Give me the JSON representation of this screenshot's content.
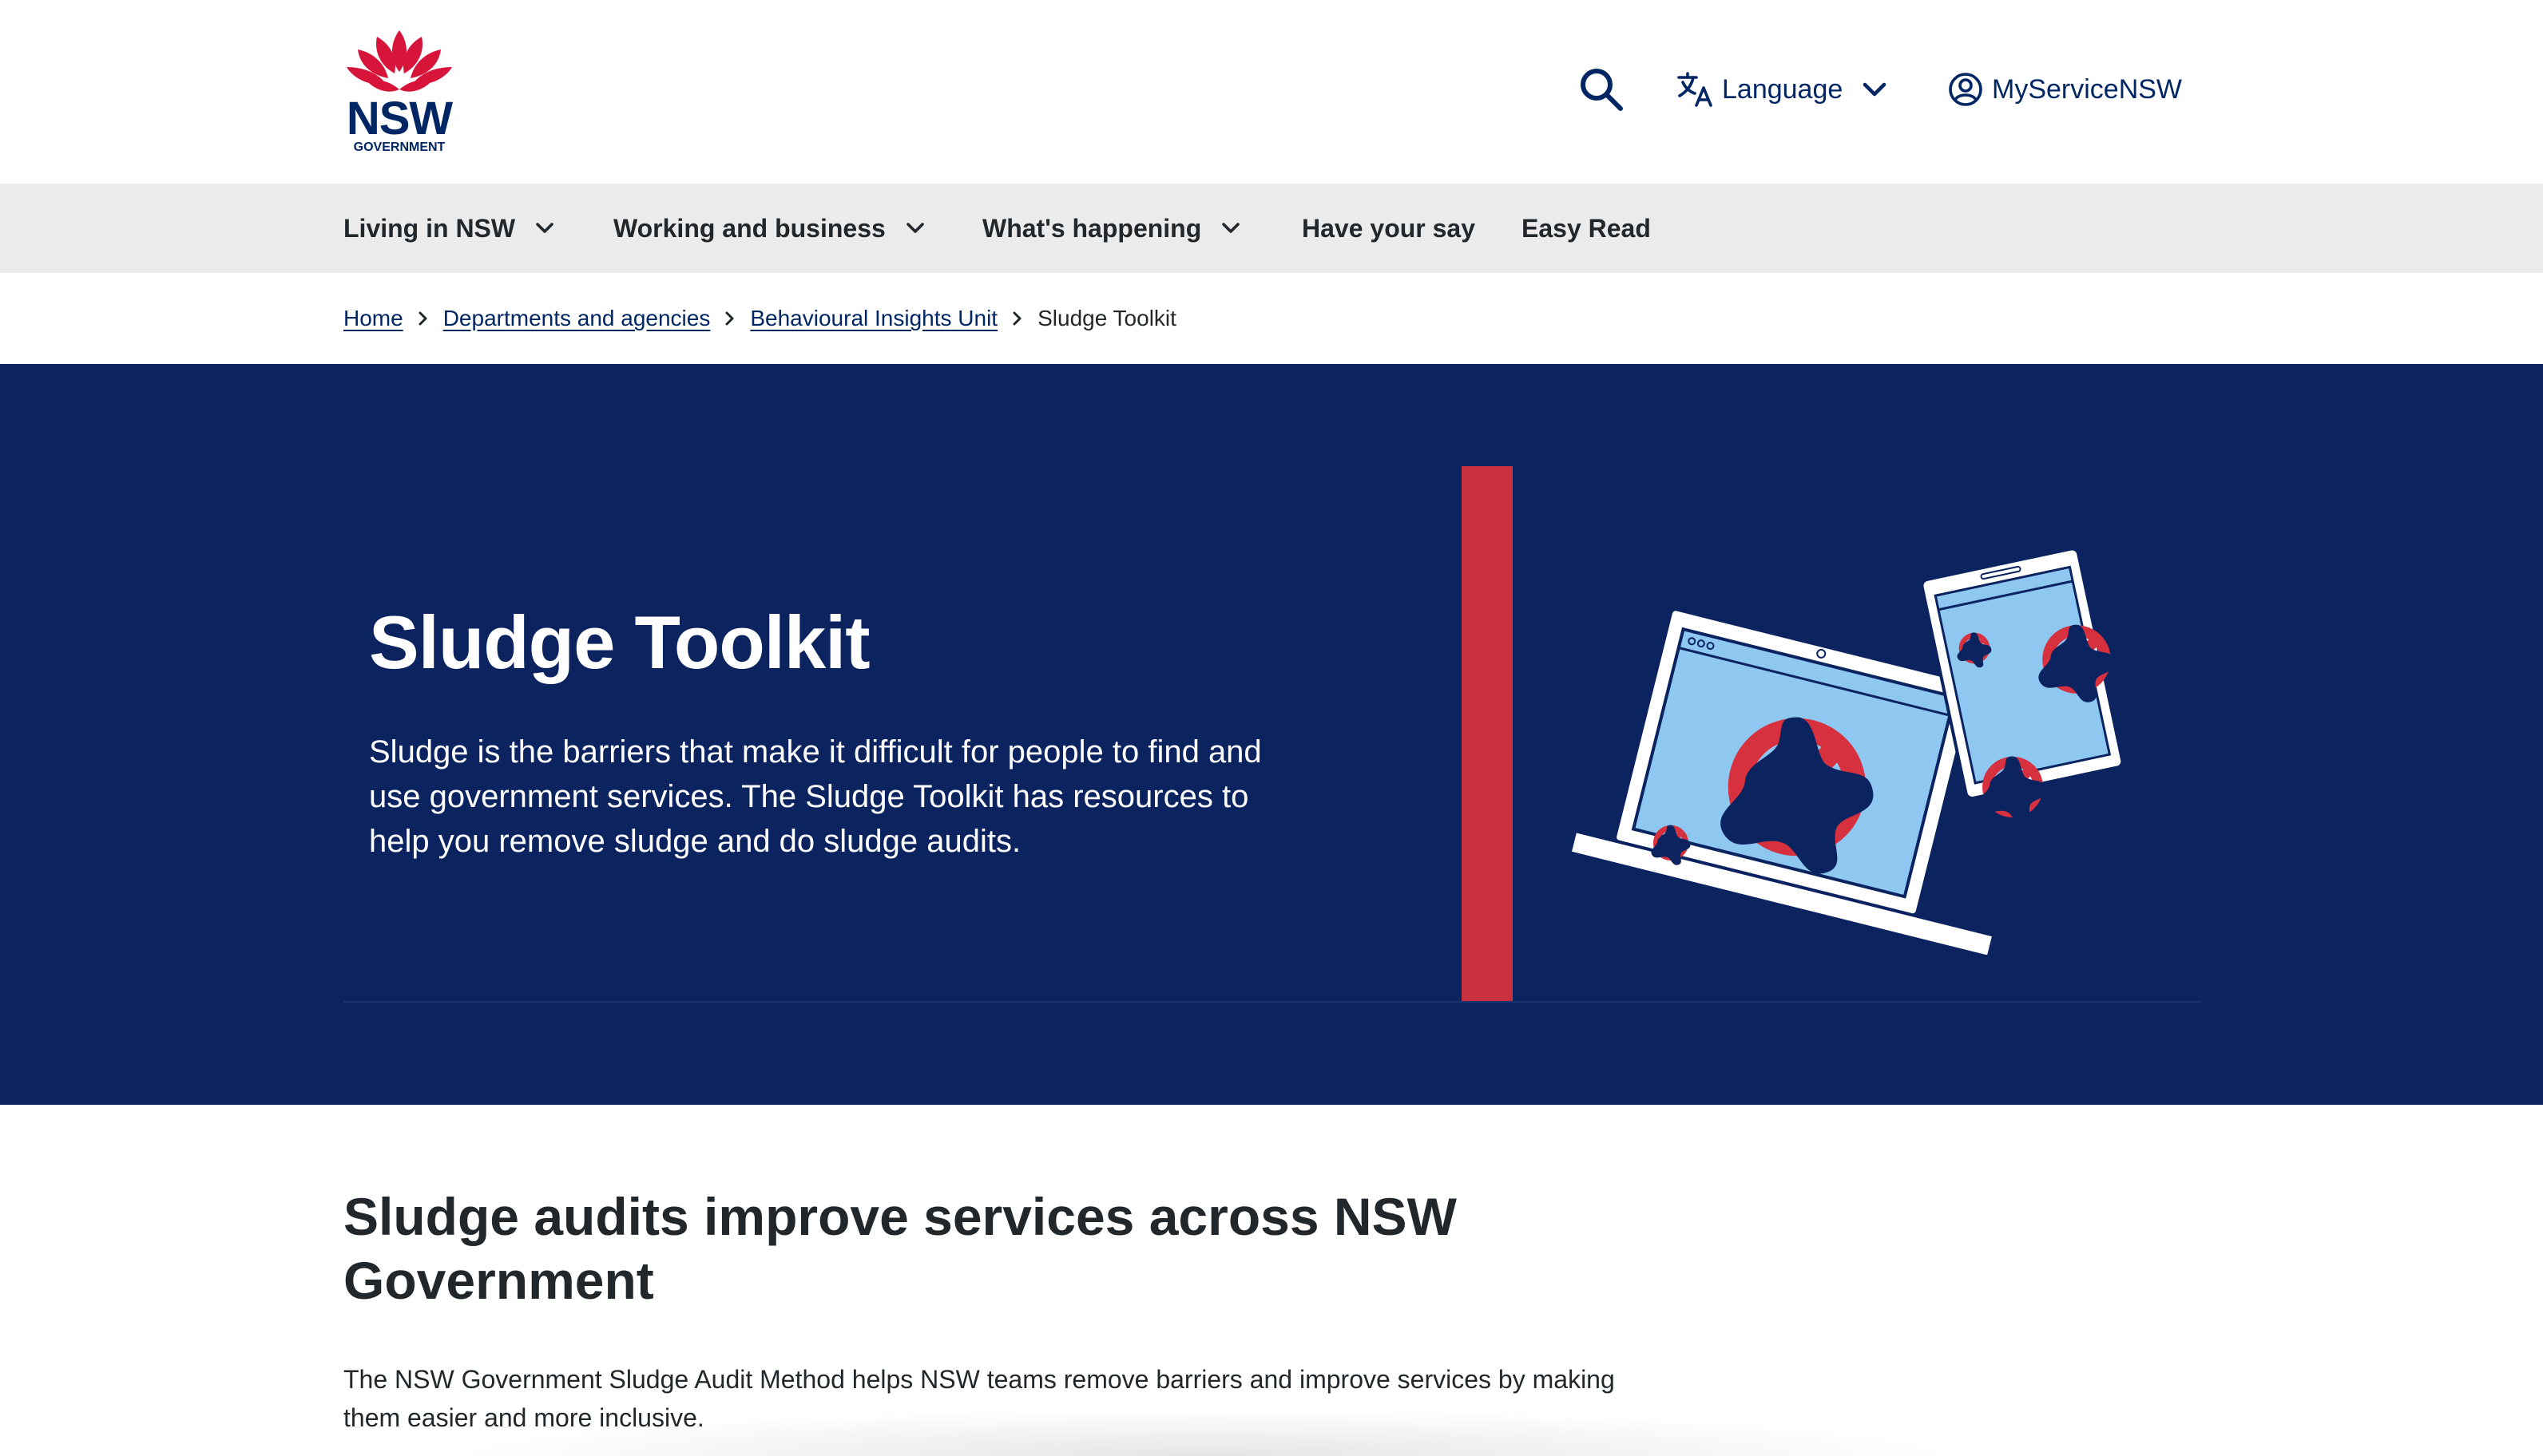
{
  "brand": {
    "logo_text": "NSW",
    "logo_subtext": "GOVERNMENT",
    "primary_color": "#002664",
    "accent_color": "#c9303e",
    "hero_bg": "#0b2460"
  },
  "header": {
    "search_icon": "search-icon",
    "language_label": "Language",
    "account_label": "MyServiceNSW"
  },
  "nav": {
    "items": [
      {
        "label": "Living in NSW",
        "has_dropdown": true
      },
      {
        "label": "Working and business",
        "has_dropdown": true
      },
      {
        "label": "What's happening",
        "has_dropdown": true
      },
      {
        "label": "Have your say",
        "has_dropdown": false
      },
      {
        "label": "Easy Read",
        "has_dropdown": false
      }
    ]
  },
  "breadcrumb": {
    "items": [
      {
        "label": "Home",
        "link": true
      },
      {
        "label": "Departments and agencies",
        "link": true
      },
      {
        "label": "Behavioural Insights Unit",
        "link": true
      },
      {
        "label": "Sludge Toolkit",
        "link": false
      }
    ]
  },
  "hero": {
    "title": "Sludge Toolkit",
    "intro": "Sludge is the barriers that make it difficult for people to find and use government services. The Sludge Toolkit has resources to help you remove sludge and do sludge audits."
  },
  "content": {
    "heading": "Sludge audits improve services across NSW Government",
    "paragraph": "The NSW Government Sludge Audit Method helps NSW teams remove barriers and improve services by making them easier and more inclusive."
  }
}
